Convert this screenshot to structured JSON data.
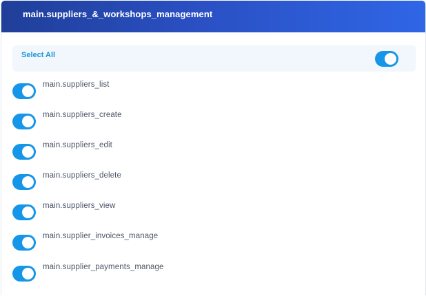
{
  "header": {
    "title": "main.suppliers_&_workshops_management"
  },
  "select_all": {
    "label": "Select All",
    "checked": true
  },
  "permissions": [
    {
      "label": "main.suppliers_list",
      "checked": true
    },
    {
      "label": "main.suppliers_create",
      "checked": true
    },
    {
      "label": "main.suppliers_edit",
      "checked": true
    },
    {
      "label": "main.suppliers_delete",
      "checked": true
    },
    {
      "label": "main.suppliers_view",
      "checked": true
    },
    {
      "label": "main.supplier_invoices_manage",
      "checked": true
    },
    {
      "label": "main.supplier_payments_manage",
      "checked": true
    }
  ],
  "colors": {
    "header_start": "#1f3f99",
    "header_end": "#2f66e6",
    "toggle_on": "#1596e8",
    "select_all_text": "#1a95d8",
    "select_all_bg": "#f1f7fc"
  }
}
